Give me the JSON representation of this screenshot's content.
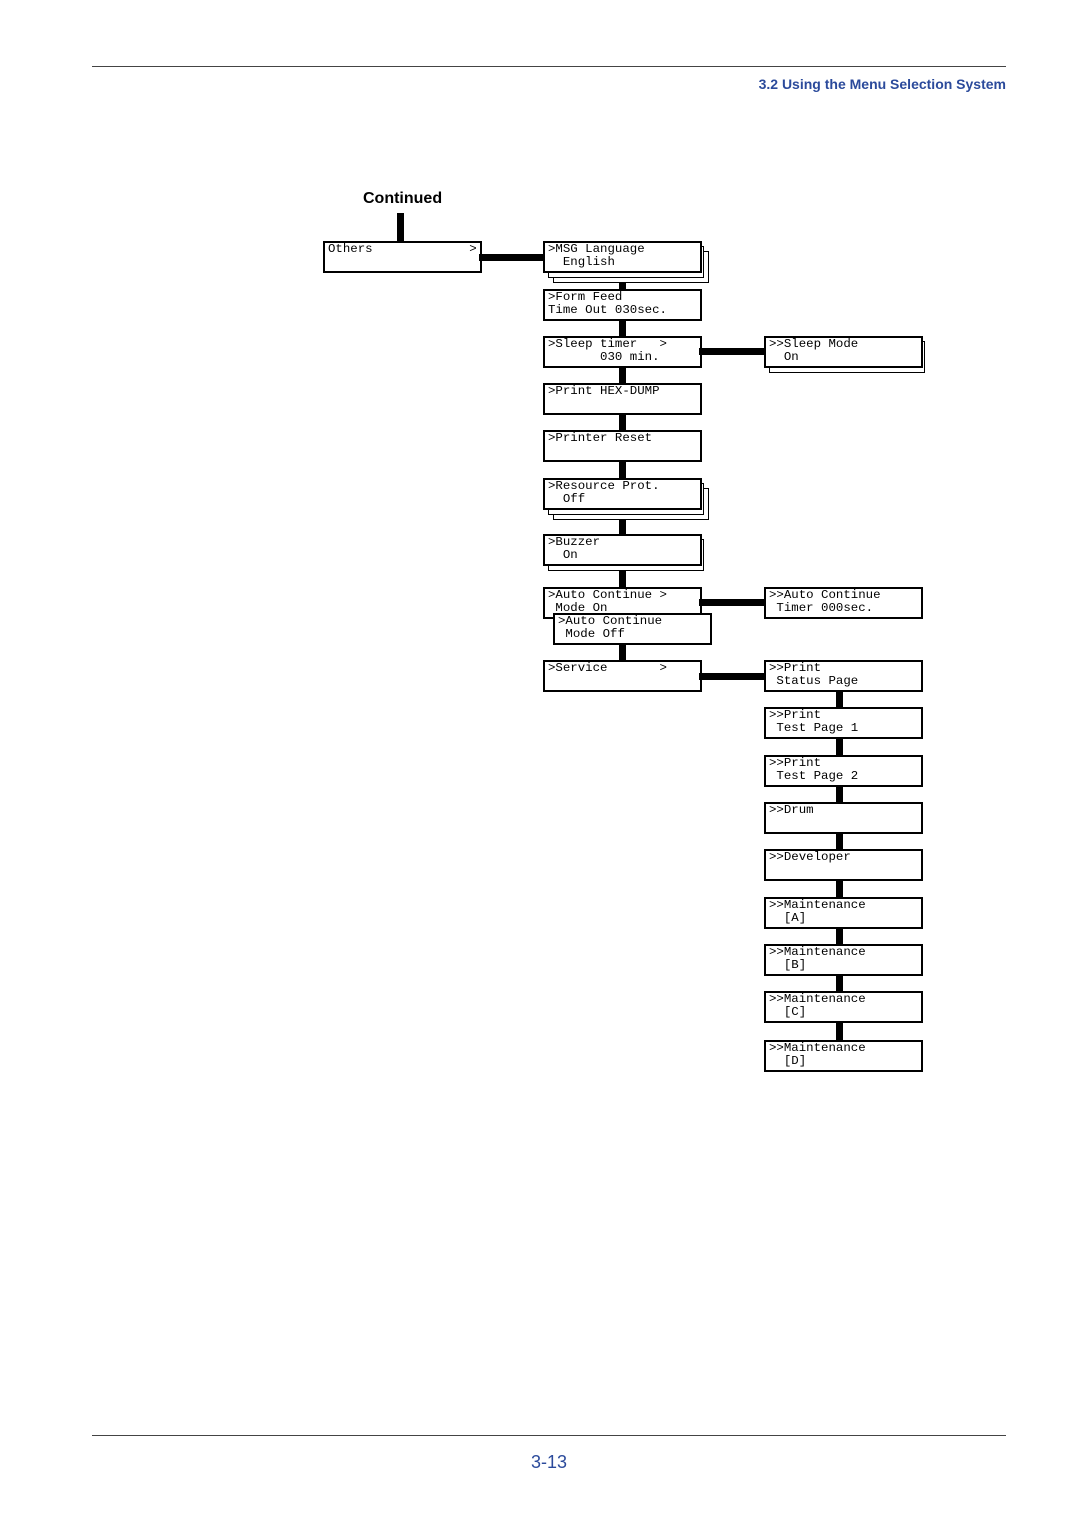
{
  "header": {
    "section_title": "3.2 Using the Menu Selection System"
  },
  "diagram": {
    "heading": "Continued",
    "root": {
      "line1": "Others",
      "arrow": ">",
      "line2": ""
    },
    "main_items": [
      {
        "line1": ">MSG Language",
        "line2": "  English",
        "stacked": 2
      },
      {
        "line1": ">Form Feed",
        "line2": "Time Out 030sec.",
        "stacked": 0
      },
      {
        "line1": ">Sleep timer   >",
        "line2": "       030 min.",
        "stacked": 0
      },
      {
        "line1": ">Print HEX-DUMP",
        "line2": "",
        "stacked": 0
      },
      {
        "line1": ">Printer Reset",
        "line2": "",
        "stacked": 0
      },
      {
        "line1": ">Resource Prot.",
        "line2": "  Off",
        "stacked": 2
      },
      {
        "line1": ">Buzzer",
        "line2": "  On",
        "stacked": 1
      },
      {
        "line1": ">Auto Continue >",
        "line2": " Mode On",
        "stacked": 0
      },
      {
        "line1": ">Auto Continue",
        "line2": " Mode Off",
        "stacked": 0
      },
      {
        "line1": ">Service       >",
        "line2": "",
        "stacked": 0
      }
    ],
    "sub_items": [
      {
        "line1": ">>Sleep Mode",
        "line2": "  On",
        "stacked": 1
      },
      {
        "line1": ">>Auto Continue",
        "line2": " Timer 000sec.",
        "stacked": 0
      },
      {
        "line1": ">>Print",
        "line2": " Status Page",
        "stacked": 0
      },
      {
        "line1": ">>Print",
        "line2": " Test Page 1",
        "stacked": 0
      },
      {
        "line1": ">>Print",
        "line2": " Test Page 2",
        "stacked": 0
      },
      {
        "line1": ">>Drum",
        "line2": "",
        "stacked": 0
      },
      {
        "line1": ">>Developer",
        "line2": "",
        "stacked": 0
      },
      {
        "line1": ">>Maintenance",
        "line2": "  [A]",
        "stacked": 0
      },
      {
        "line1": ">>Maintenance",
        "line2": "  [B]",
        "stacked": 0
      },
      {
        "line1": ">>Maintenance",
        "line2": "  [C]",
        "stacked": 0
      },
      {
        "line1": ">>Maintenance",
        "line2": "  [D]",
        "stacked": 0
      }
    ]
  },
  "footer": {
    "page_number": "3-13"
  }
}
